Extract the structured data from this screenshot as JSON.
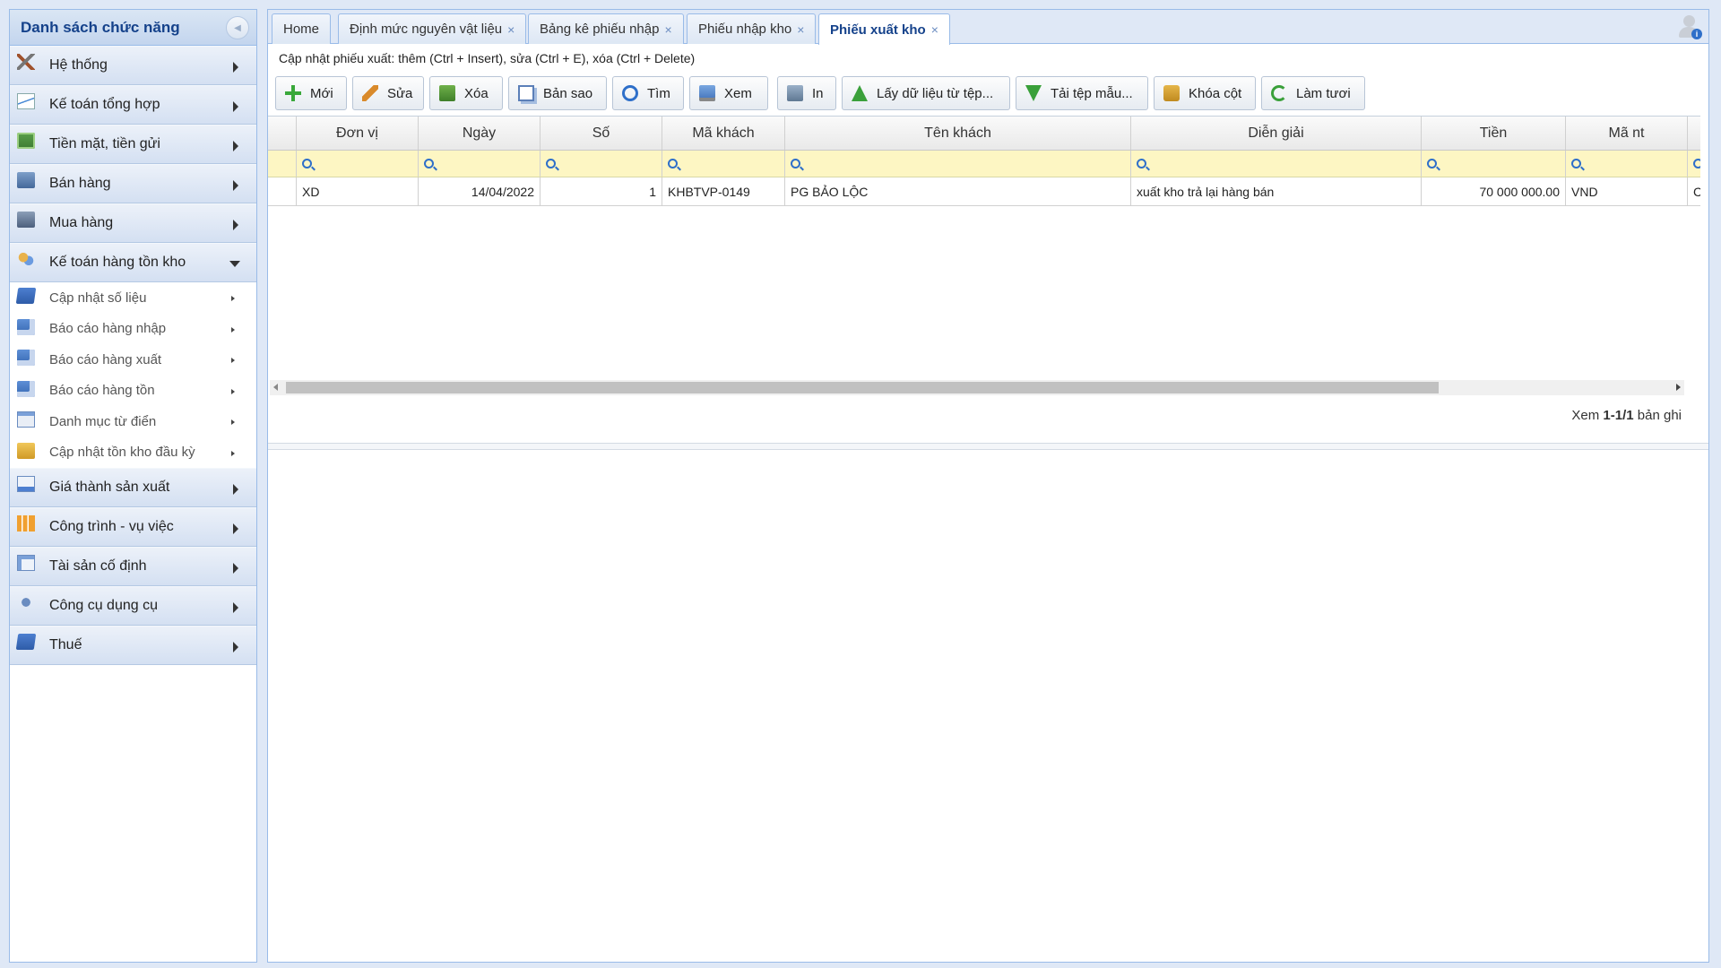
{
  "sidebar": {
    "title": "Danh sách chức năng",
    "collapse_icon": "collapse-left-icon",
    "items": [
      {
        "label": "Hệ thống",
        "icon": "tools-icon"
      },
      {
        "label": "Kế toán tổng hợp",
        "icon": "chart-icon"
      },
      {
        "label": "Tiền mặt, tiền gửi",
        "icon": "money-icon"
      },
      {
        "label": "Bán hàng",
        "icon": "sales-icon"
      },
      {
        "label": "Mua hàng",
        "icon": "purchase-icon"
      },
      {
        "label": "Kế toán hàng tồn kho",
        "icon": "inventory-icon",
        "expanded": true
      },
      {
        "label": "Giá thành sản xuất",
        "icon": "cost-icon"
      },
      {
        "label": "Công trình - vụ việc",
        "icon": "project-icon"
      },
      {
        "label": "Tài sản cố định",
        "icon": "asset-icon"
      },
      {
        "label": "Công cụ dụng cụ",
        "icon": "tool-icon"
      },
      {
        "label": "Thuế",
        "icon": "tax-icon"
      }
    ],
    "subitems": [
      {
        "label": "Cập nhật số liệu",
        "icon": "update-icon"
      },
      {
        "label": "Báo cáo hàng nhập",
        "icon": "report-icon"
      },
      {
        "label": "Báo cáo hàng xuất",
        "icon": "report-icon"
      },
      {
        "label": "Báo cáo hàng tồn",
        "icon": "report-icon"
      },
      {
        "label": "Danh mục từ điển",
        "icon": "dictionary-icon"
      },
      {
        "label": "Cập nhật tồn kho đầu kỳ",
        "icon": "pen-icon"
      }
    ]
  },
  "tabs": [
    {
      "label": "Home",
      "closable": false
    },
    {
      "label": "Định mức nguyên vật liệu",
      "closable": true
    },
    {
      "label": "Bảng kê phiếu nhập",
      "closable": true
    },
    {
      "label": "Phiếu nhập kho",
      "closable": true
    },
    {
      "label": "Phiếu xuất kho",
      "closable": true,
      "active": true
    }
  ],
  "tab_close_glyph": "×",
  "hint": "Cập nhật phiếu xuất: thêm (Ctrl + Insert), sửa (Ctrl + E), xóa (Ctrl + Delete)",
  "toolbar": {
    "new": "Mới",
    "edit": "Sửa",
    "delete": "Xóa",
    "copy": "Bản sao",
    "find": "Tìm",
    "view": "Xem",
    "print": "In",
    "import": "Lấy dữ liệu từ tệp...",
    "template": "Tải tệp mẫu...",
    "lock": "Khóa cột",
    "refresh": "Làm tươi"
  },
  "grid": {
    "columns": [
      "Đơn vị",
      "Ngày",
      "Số",
      "Mã khách",
      "Tên khách",
      "Diễn giải",
      "Tiền",
      "Mã nt",
      ""
    ],
    "rows": [
      {
        "don_vi": "XD",
        "ngay": "14/04/2022",
        "so": "1",
        "ma_khach": "KHBTVP-0149",
        "ten_khach": "PG BẢO LỘC",
        "dien_giai": "xuất kho trả lại hàng bán",
        "tien": "70 000 000.00",
        "ma_nt": "VND",
        "extra": "Cl"
      }
    ]
  },
  "paging": {
    "prefix": "Xem",
    "range": "1-1/1",
    "suffix": "bản ghi"
  },
  "colors": {
    "accent": "#15428b",
    "border": "#99bbe8",
    "filter_bg": "#fdf6c3"
  }
}
